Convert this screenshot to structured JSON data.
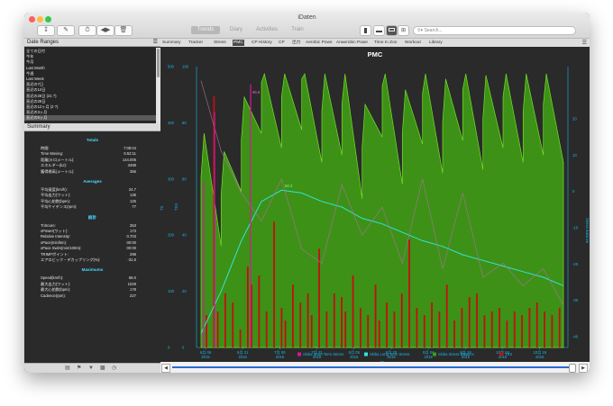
{
  "app": {
    "title": "iDaten"
  },
  "toolbar": {
    "segments": [
      {
        "label": "Trends",
        "active": true
      },
      {
        "label": "Diary",
        "active": false
      },
      {
        "label": "Activities",
        "active": false
      },
      {
        "label": "Train",
        "active": false
      }
    ],
    "search_placeholder": "Search..."
  },
  "date_ranges": {
    "header": "Date Ranges",
    "items": [
      "全ての日付",
      "今年",
      "今月",
      "Last Month",
      "今週",
      "Last Week",
      "直近の7日",
      "直近の14日",
      "直近の28日 (21 ?)",
      "直近の28日",
      "直近の12ヶ月 (2 ?)",
      "直近の3ヶ月",
      "直近の6ヶ月"
    ]
  },
  "summary": {
    "header": "Summary",
    "sections": [
      {
        "title": "Totals",
        "rows": [
          [
            "時間:",
            "7:08:04"
          ],
          [
            "Time Moving:",
            "5:52:11"
          ],
          [
            "距離(キロメートル):",
            "144.006"
          ],
          [
            "エネルギー(kJ):",
            "3498"
          ],
          [
            "獲得標高(メートル):",
            "355"
          ]
        ]
      },
      {
        "title": "Averages",
        "rows": [
          [
            "平均速度(km/h):",
            "24.7"
          ],
          [
            "平均出力(ワット):",
            "136"
          ],
          [
            "平均心拍数(bpm):",
            "125"
          ],
          [
            "平均ケイデンス(rpm):",
            "77"
          ]
        ]
      },
      {
        "title": "統計",
        "rows": [
          [
            "TriScore:",
            "353"
          ],
          [
            "xPower(ワット):",
            "173"
          ],
          [
            "Relative Intensity:",
            "0.703"
          ],
          [
            "xPace(min/km):",
            "00:00"
          ],
          [
            "xPace Swim(min/100m):",
            "00:00"
          ],
          [
            "TRIMPポイント:",
            "298"
          ],
          [
            "エアロビック・デカップリング(%):",
            "-31.5"
          ]
        ]
      },
      {
        "title": "Maximums",
        "rows": [
          [
            "Speed(km/h):",
            "58.0"
          ],
          [
            "最大出力(ワット):",
            "1029"
          ],
          [
            "最大心拍数(bpm):",
            "178"
          ],
          [
            "Cadence(rpm):",
            "227"
          ]
        ]
      }
    ]
  },
  "chart_tabs": [
    "Summary",
    "Tracker",
    "Stress",
    "PMC",
    "CP History",
    "CP",
    "出力",
    "Aerobic Powe",
    "Anaerobic Powe",
    "Time In Zon",
    "Workout",
    "Library"
  ],
  "active_tab": "PMC",
  "colors": {
    "short_term": "#d6189a",
    "long_term": "#2ee6d8",
    "balance": "#3aa010",
    "tss": "#c21010",
    "axis": "#18b8e8"
  },
  "chart_data": {
    "type": "line",
    "title": "PMC",
    "xlabel": "Dt",
    "y_left_outer": {
      "label": "TS",
      "ticks": [
        "0",
        "100",
        "200",
        "300",
        "400",
        "500"
      ]
    },
    "y_left_inner": {
      "label": "TSS",
      "ticks": [
        "0",
        "20",
        "40",
        "60",
        "80",
        "100"
      ]
    },
    "y_right": {
      "label": "Stress Balance",
      "ticks": [
        "-40",
        "-30",
        "-20",
        "-10",
        "0",
        "10",
        "20"
      ]
    },
    "x_ticks": [
      "6月 06\n2015",
      "6月 21\n2015",
      "7月 06\n2015",
      "7月 21\n2015",
      "8月 05\n2015",
      "8月 20\n2015",
      "9月 04\n2015",
      "9月 19\n2015",
      "10月 04\n2015",
      "10月 19\n2015"
    ],
    "annotations": [
      "96.8",
      "58.3"
    ],
    "legend": [
      {
        "name": "Skiba Short Term Stress",
        "color": "#d6189a"
      },
      {
        "name": "Skiba Long Term Stress",
        "color": "#2ee6d8"
      },
      {
        "name": "Skiba Stress Balance",
        "color": "#3aa010"
      },
      {
        "name": "TSS",
        "color": "#c21010"
      }
    ],
    "series": [
      {
        "name": "Skiba Long Term Stress",
        "values": [
          5,
          20,
          38,
          52,
          56,
          55,
          52,
          50,
          46,
          44,
          41,
          38,
          36,
          33,
          31,
          29,
          27,
          25,
          22
        ]
      },
      {
        "name": "Skiba Short Term Stress",
        "values": [
          95,
          70,
          55,
          45,
          60,
          35,
          30,
          58,
          40,
          50,
          30,
          60,
          28,
          55,
          25,
          30,
          22,
          28,
          15
        ]
      },
      {
        "name": "Skiba Stress Balance",
        "values": [
          0,
          -5,
          10,
          26,
          22,
          27,
          18,
          20,
          8,
          25,
          12,
          23,
          15,
          24,
          16,
          22,
          18,
          20,
          18
        ]
      }
    ],
    "tss_bars": [
      0,
      18,
      0,
      140,
      20,
      0,
      30,
      0,
      25,
      0,
      10,
      0,
      45,
      35,
      0,
      40,
      0,
      20,
      0,
      70,
      0,
      22,
      15,
      0,
      35,
      0,
      25,
      0,
      30,
      18,
      0,
      55,
      0,
      20,
      0,
      30,
      0,
      28,
      20,
      0,
      40,
      0,
      22,
      0,
      18,
      0,
      35,
      15,
      0,
      25,
      0,
      20,
      0,
      30,
      0,
      60,
      0,
      22,
      0,
      18,
      0,
      25,
      0,
      20,
      0,
      35,
      0,
      15,
      0,
      22,
      0,
      28,
      0,
      30,
      0,
      18,
      0,
      20,
      0,
      22,
      0,
      15,
      0,
      20,
      0,
      18,
      0,
      22,
      0,
      25,
      0,
      20,
      0,
      18,
      0,
      22
    ]
  }
}
